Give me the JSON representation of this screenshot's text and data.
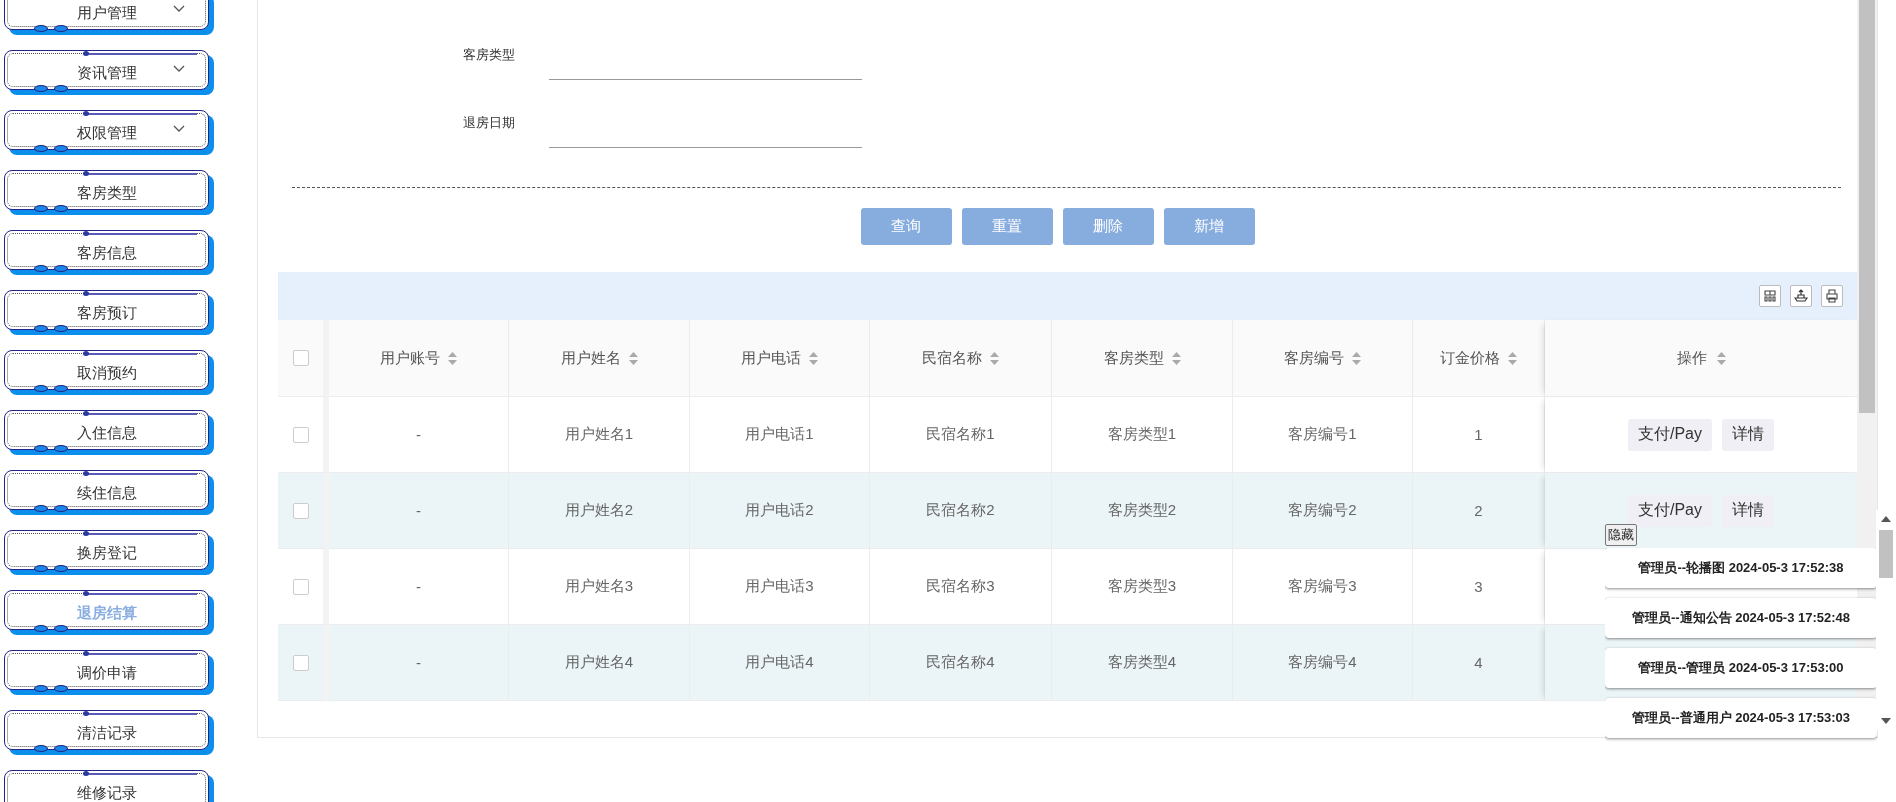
{
  "sidebar": {
    "items": [
      {
        "label": "用户管理",
        "kind": "group",
        "selected": false
      },
      {
        "label": "资讯管理",
        "kind": "group",
        "selected": false
      },
      {
        "label": "权限管理",
        "kind": "group",
        "selected": false
      },
      {
        "label": "客房类型",
        "kind": "link",
        "selected": false
      },
      {
        "label": "客房信息",
        "kind": "link",
        "selected": false
      },
      {
        "label": "客房预订",
        "kind": "link",
        "selected": false
      },
      {
        "label": "取消预约",
        "kind": "link",
        "selected": false
      },
      {
        "label": "入住信息",
        "kind": "link",
        "selected": false
      },
      {
        "label": "续住信息",
        "kind": "link",
        "selected": false
      },
      {
        "label": "换房登记",
        "kind": "link",
        "selected": false
      },
      {
        "label": "退房结算",
        "kind": "link",
        "selected": true
      },
      {
        "label": "调价申请",
        "kind": "link",
        "selected": false
      },
      {
        "label": "清洁记录",
        "kind": "link",
        "selected": false
      },
      {
        "label": "维修记录",
        "kind": "link",
        "selected": false
      }
    ]
  },
  "search_form": {
    "fields": [
      {
        "label": "客房类型"
      },
      {
        "label": "退房日期"
      }
    ]
  },
  "buttons": [
    "查询",
    "重置",
    "删除",
    "新增"
  ],
  "table": {
    "select_all_checked": false,
    "columns": [
      "用户账号",
      "用户姓名",
      "用户电话",
      "民宿名称",
      "客房类型",
      "客房编号",
      "订金价格",
      "操作"
    ],
    "rows": [
      {
        "checked": false,
        "cells": [
          "-",
          "用户姓名1",
          "用户电话1",
          "民宿名称1",
          "客房类型1",
          "客房编号1",
          "1"
        ],
        "actions": [
          "支付/Pay",
          "详情"
        ]
      },
      {
        "checked": false,
        "cells": [
          "-",
          "用户姓名2",
          "用户电话2",
          "民宿名称2",
          "客房类型2",
          "客房编号2",
          "2"
        ],
        "actions": [
          "支付/Pay",
          "详情"
        ]
      },
      {
        "checked": false,
        "cells": [
          "-",
          "用户姓名3",
          "用户电话3",
          "民宿名称3",
          "客房类型3",
          "客房编号3",
          "3"
        ]
      },
      {
        "checked": false,
        "cells": [
          "-",
          "用户姓名4",
          "用户电话4",
          "民宿名称4",
          "客房类型4",
          "客房编号4",
          "4"
        ]
      }
    ]
  },
  "notifications": {
    "hide_button": "隐藏",
    "items": [
      "管理员--轮播图 2024-05-3 17:52:38",
      "管理员--通知公告 2024-05-3 17:52:48",
      "管理员--管理员 2024-05-3 17:53:00",
      "管理员--普通用户 2024-05-3 17:53:03"
    ]
  }
}
